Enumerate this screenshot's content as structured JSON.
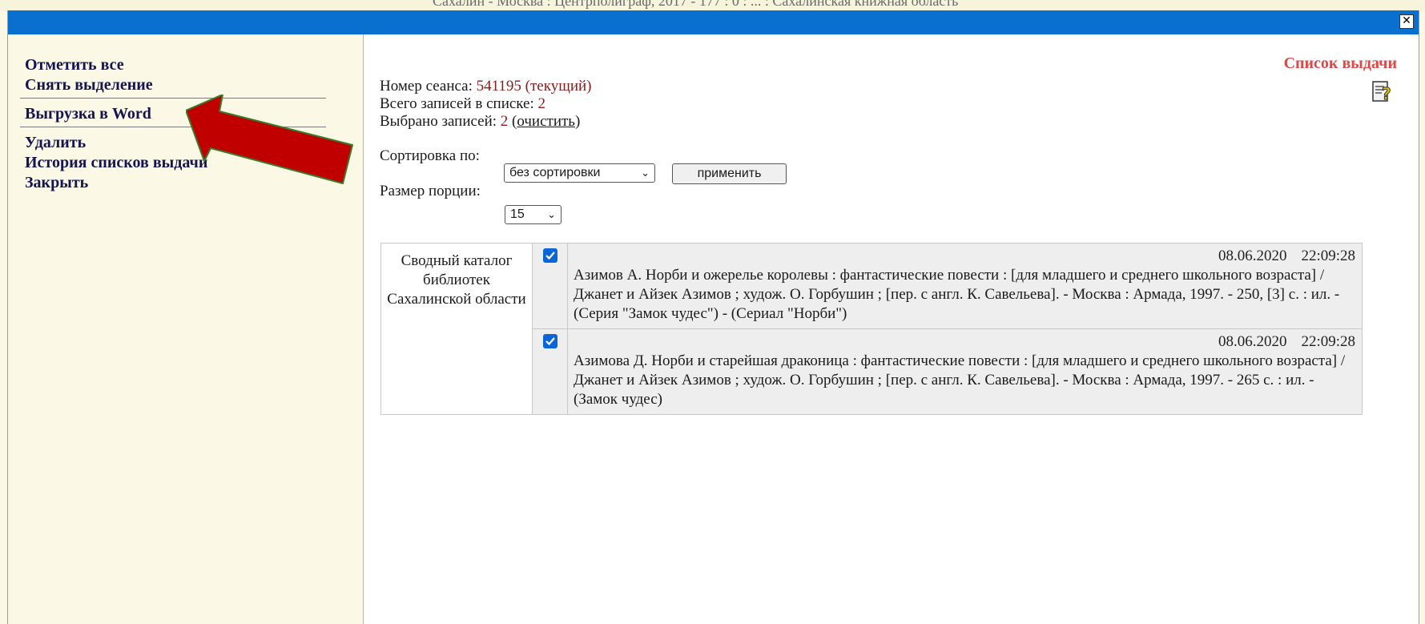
{
  "background_caption": "Сахалин - Москва : Центрполиграф, 2017 - 177 : 0 : ... : Сахалинская книжная область",
  "sidebar": {
    "items": [
      {
        "label": "Отметить все"
      },
      {
        "label": "Снять выделение"
      },
      {
        "label": "Выгрузка в Word"
      },
      {
        "label": "Удалить"
      },
      {
        "label": "История списков выдачи"
      },
      {
        "label": "Закрыть"
      }
    ]
  },
  "header": {
    "title": "Список выдачи"
  },
  "session": {
    "label": "Номер сеанса:",
    "value": "541195 (текущий)",
    "total_label": "Всего записей в списке:",
    "total_value": "2",
    "selected_label": "Выбрано записей:",
    "selected_value": "2",
    "clear_link": "очистить"
  },
  "sort": {
    "label": "Сортировка по:",
    "selected": "без сортировки",
    "apply_label": "применить"
  },
  "portion": {
    "label": "Размер порции:",
    "selected": "15"
  },
  "records": {
    "source": "Сводный каталог библиотек Сахалинской области",
    "items": [
      {
        "checked": true,
        "date": "08.06.2020",
        "time": "22:09:28",
        "text": "Азимов А. Норби и ожерелье королевы : фантастические повести : [для младшего и среднего школьного возраста] / Джанет и Айзек Азимов ; худож. О. Горбушин ; [пер. с англ. К. Савельева]. - Москва : Армада, 1997. - 250, [3] с. : ил. - (Серия \"Замок чудес\") - (Сериал \"Норби\")"
      },
      {
        "checked": true,
        "date": "08.06.2020",
        "time": "22:09:28",
        "text": "Азимова Д. Норби и старейшая драконица : фантастические повести : [для младшего и среднего школьного возраста] / Джанет и Айзек Азимов ; худож. О. Горбушин ; [пер. с англ. К. Савельева]. - Москва : Армада, 1997. - 265 с. : ил. - (Замок чудес)"
      }
    ]
  },
  "colors": {
    "titlebar": "#0a70d0",
    "accent_title": "#d94a4a",
    "value_red": "#8b1a1a",
    "arrow": "#c00000",
    "arrow_outline": "#3a7a2a"
  },
  "icons": {
    "close": "close-icon",
    "help": "help-icon",
    "checkbox": "checkbox-checked-icon",
    "annotation": "red-arrow-annotation"
  }
}
